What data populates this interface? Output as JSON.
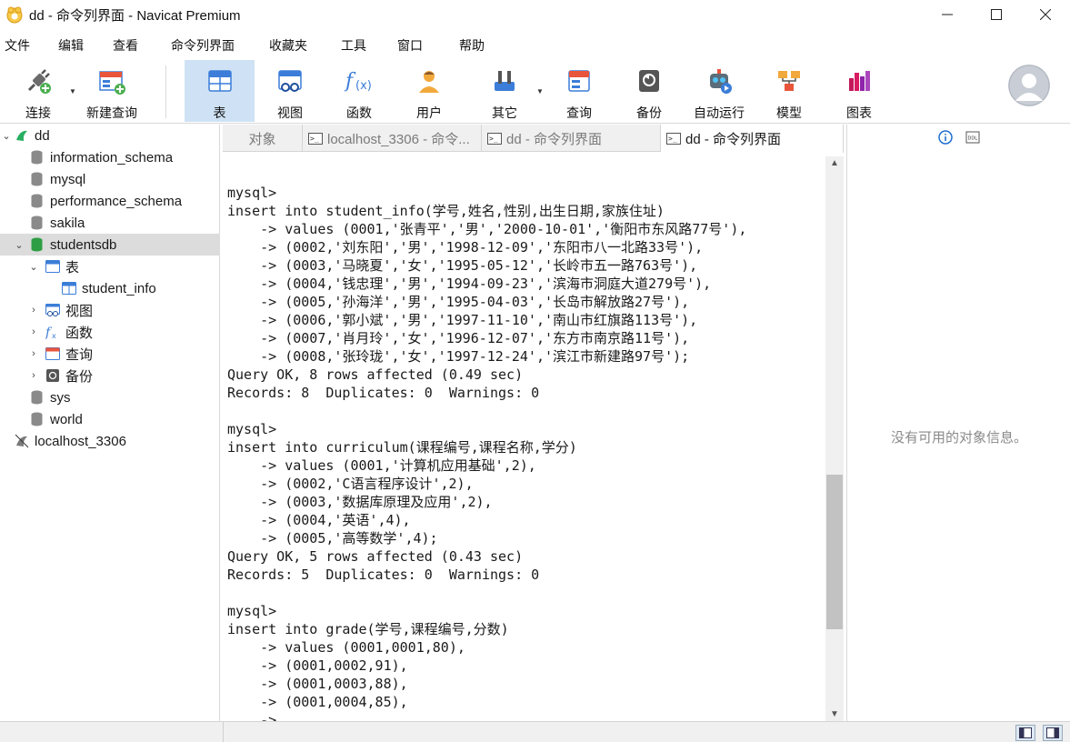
{
  "window": {
    "title": "dd - 命令列界面 - Navicat Premium",
    "icon": "navicat-logo-icon",
    "controls": [
      "minimize-icon",
      "maximize-icon",
      "close-icon"
    ]
  },
  "menu": [
    "文件",
    "编辑",
    "查看",
    "命令列界面",
    "收藏夹",
    "工具",
    "窗口",
    "帮助"
  ],
  "toolbar": {
    "connect": "连接",
    "new_query": "新建查询",
    "table": "表",
    "view": "视图",
    "function": "函数",
    "user": "用户",
    "other": "其它",
    "query": "查询",
    "backup": "备份",
    "auto_run": "自动运行",
    "model": "模型",
    "chart": "图表"
  },
  "tree": {
    "connection": "dd",
    "databases": [
      "information_schema",
      "mysql",
      "performance_schema",
      "sakila"
    ],
    "selected_db": "studentsdb",
    "tables_group": "表",
    "table_item": "student_info",
    "view_group": "视图",
    "function_group": "函数",
    "query_group": "查询",
    "backup_group": "备份",
    "other_dbs": [
      "sys",
      "world"
    ],
    "connection2": "localhost_3306"
  },
  "tabs": {
    "objects": "对象",
    "tab1": "localhost_3306 - 命令...",
    "tab2": "dd - 命令列界面",
    "tab3": "dd - 命令列界面"
  },
  "console_lines": [
    "",
    "mysql>",
    "insert into student_info(学号,姓名,性别,出生日期,家族住址)",
    "    -> values (0001,'张青平','男','2000-10-01','衡阳市东风路77号'),",
    "    -> (0002,'刘东阳','男','1998-12-09','东阳市八一北路33号'),",
    "    -> (0003,'马晓夏','女','1995-05-12','长岭市五一路763号'),",
    "    -> (0004,'钱忠理','男','1994-09-23','滨海市洞庭大道279号'),",
    "    -> (0005,'孙海洋','男','1995-04-03','长岛市解放路27号'),",
    "    -> (0006,'郭小斌','男','1997-11-10','南山市红旗路113号'),",
    "    -> (0007,'肖月玲','女','1996-12-07','东方市南京路11号'),",
    "    -> (0008,'张玲珑','女','1997-12-24','滨江市新建路97号');",
    "Query OK, 8 rows affected (0.49 sec)",
    "Records: 8  Duplicates: 0  Warnings: 0",
    "",
    "mysql>",
    "insert into curriculum(课程编号,课程名称,学分)",
    "    -> values (0001,'计算机应用基础',2),",
    "    -> (0002,'C语言程序设计',2),",
    "    -> (0003,'数据库原理及应用',2),",
    "    -> (0004,'英语',4),",
    "    -> (0005,'高等数学',4);",
    "Query OK, 5 rows affected (0.43 sec)",
    "Records: 5  Duplicates: 0  Warnings: 0",
    "",
    "mysql>",
    "insert into grade(学号,课程编号,分数)",
    "    -> values (0001,0001,80),",
    "    -> (0001,0002,91),",
    "    -> (0001,0003,88),",
    "    -> (0001,0004,85),",
    "    ->"
  ],
  "info_panel": {
    "empty_text": "没有可用的对象信息。"
  }
}
